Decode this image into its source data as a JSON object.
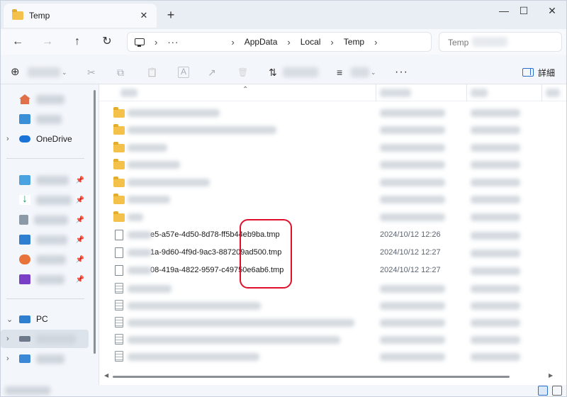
{
  "window": {
    "tab_title": "Temp",
    "tab_close": "✕",
    "new_tab": "+",
    "minimize": "—",
    "maximize": "☐",
    "close": "✕"
  },
  "navigation": {
    "back": "←",
    "forward": "→",
    "up": "↑",
    "refresh": "↻",
    "ellipsis": "···",
    "breadcrumbs": [
      "AppData",
      "Local",
      "Temp"
    ],
    "search_placeholder": "Temp"
  },
  "toolbar": {
    "new": "⊕",
    "cut": "✂",
    "copy": "⧉",
    "paste": "📋",
    "rename": "A",
    "share": "↗",
    "delete": "🗑",
    "sort": "⇅",
    "view": "≡",
    "more": "···",
    "details_label": "詳細"
  },
  "sidebar": {
    "onedrive_label": "OneDrive",
    "pc_label": "PC"
  },
  "files": [
    {
      "name_visible": "e5-a57e-4d50-8d78-ff5b44e",
      "name_tail": "b9ba.tmp",
      "date": "2024/10/12 12:26"
    },
    {
      "name_visible": "1a-9d60-4f9d-9ac3-887209a",
      "name_tail": "d500.tmp",
      "date": "2024/10/12 12:27"
    },
    {
      "name_visible": "08-419a-4822-9597-c49750e",
      "name_tail": "6ab6.tmp",
      "date": "2024/10/12 12:27"
    }
  ],
  "colors": {
    "folder": "#f4c24a",
    "highlight": "#e0102a",
    "accent": "#2a6fc9"
  }
}
